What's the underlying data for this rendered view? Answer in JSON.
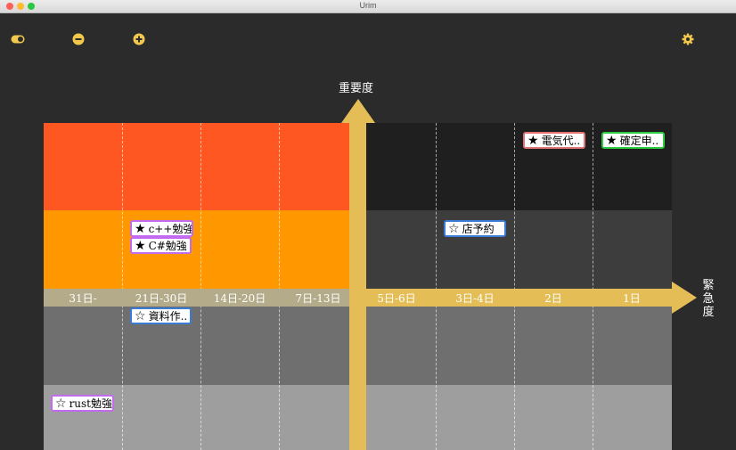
{
  "window": {
    "title": "Urim"
  },
  "toolbar": {
    "toggle_icon": "toggle-icon",
    "zoom_out_icon": "minus-circle-icon",
    "zoom_in_icon": "plus-circle-icon",
    "settings_icon": "gear-icon",
    "icon_color": "#f2c94c"
  },
  "axes": {
    "y_label": "重要度",
    "x_label_chars": [
      "緊",
      "急",
      "度"
    ],
    "x_ticks": [
      "31日-",
      "21日-30日",
      "14日-20日",
      "7日-13日",
      "5日-6日",
      "3日-4日",
      "2日",
      "1日"
    ]
  },
  "colors": {
    "axis": "#e4bd56",
    "urgent_important_high": "#ff5722",
    "urgent_important_mid": "#ff9800"
  },
  "tasks": [
    {
      "label": "電気代..",
      "starred": true,
      "border_color": "#e57373"
    },
    {
      "label": "確定申..",
      "starred": true,
      "border_color": "#2ecc40"
    },
    {
      "label": "c++勉強",
      "starred": true,
      "border_color": "#c26bf0"
    },
    {
      "label": "C#勉強",
      "starred": true,
      "border_color": "#c26bf0"
    },
    {
      "label": "店予約",
      "starred": false,
      "border_color": "#3a7bd5"
    },
    {
      "label": "資料作..",
      "starred": false,
      "border_color": "#3a7bd5"
    },
    {
      "label": "rust勉強",
      "starred": false,
      "border_color": "#c26bf0"
    }
  ]
}
